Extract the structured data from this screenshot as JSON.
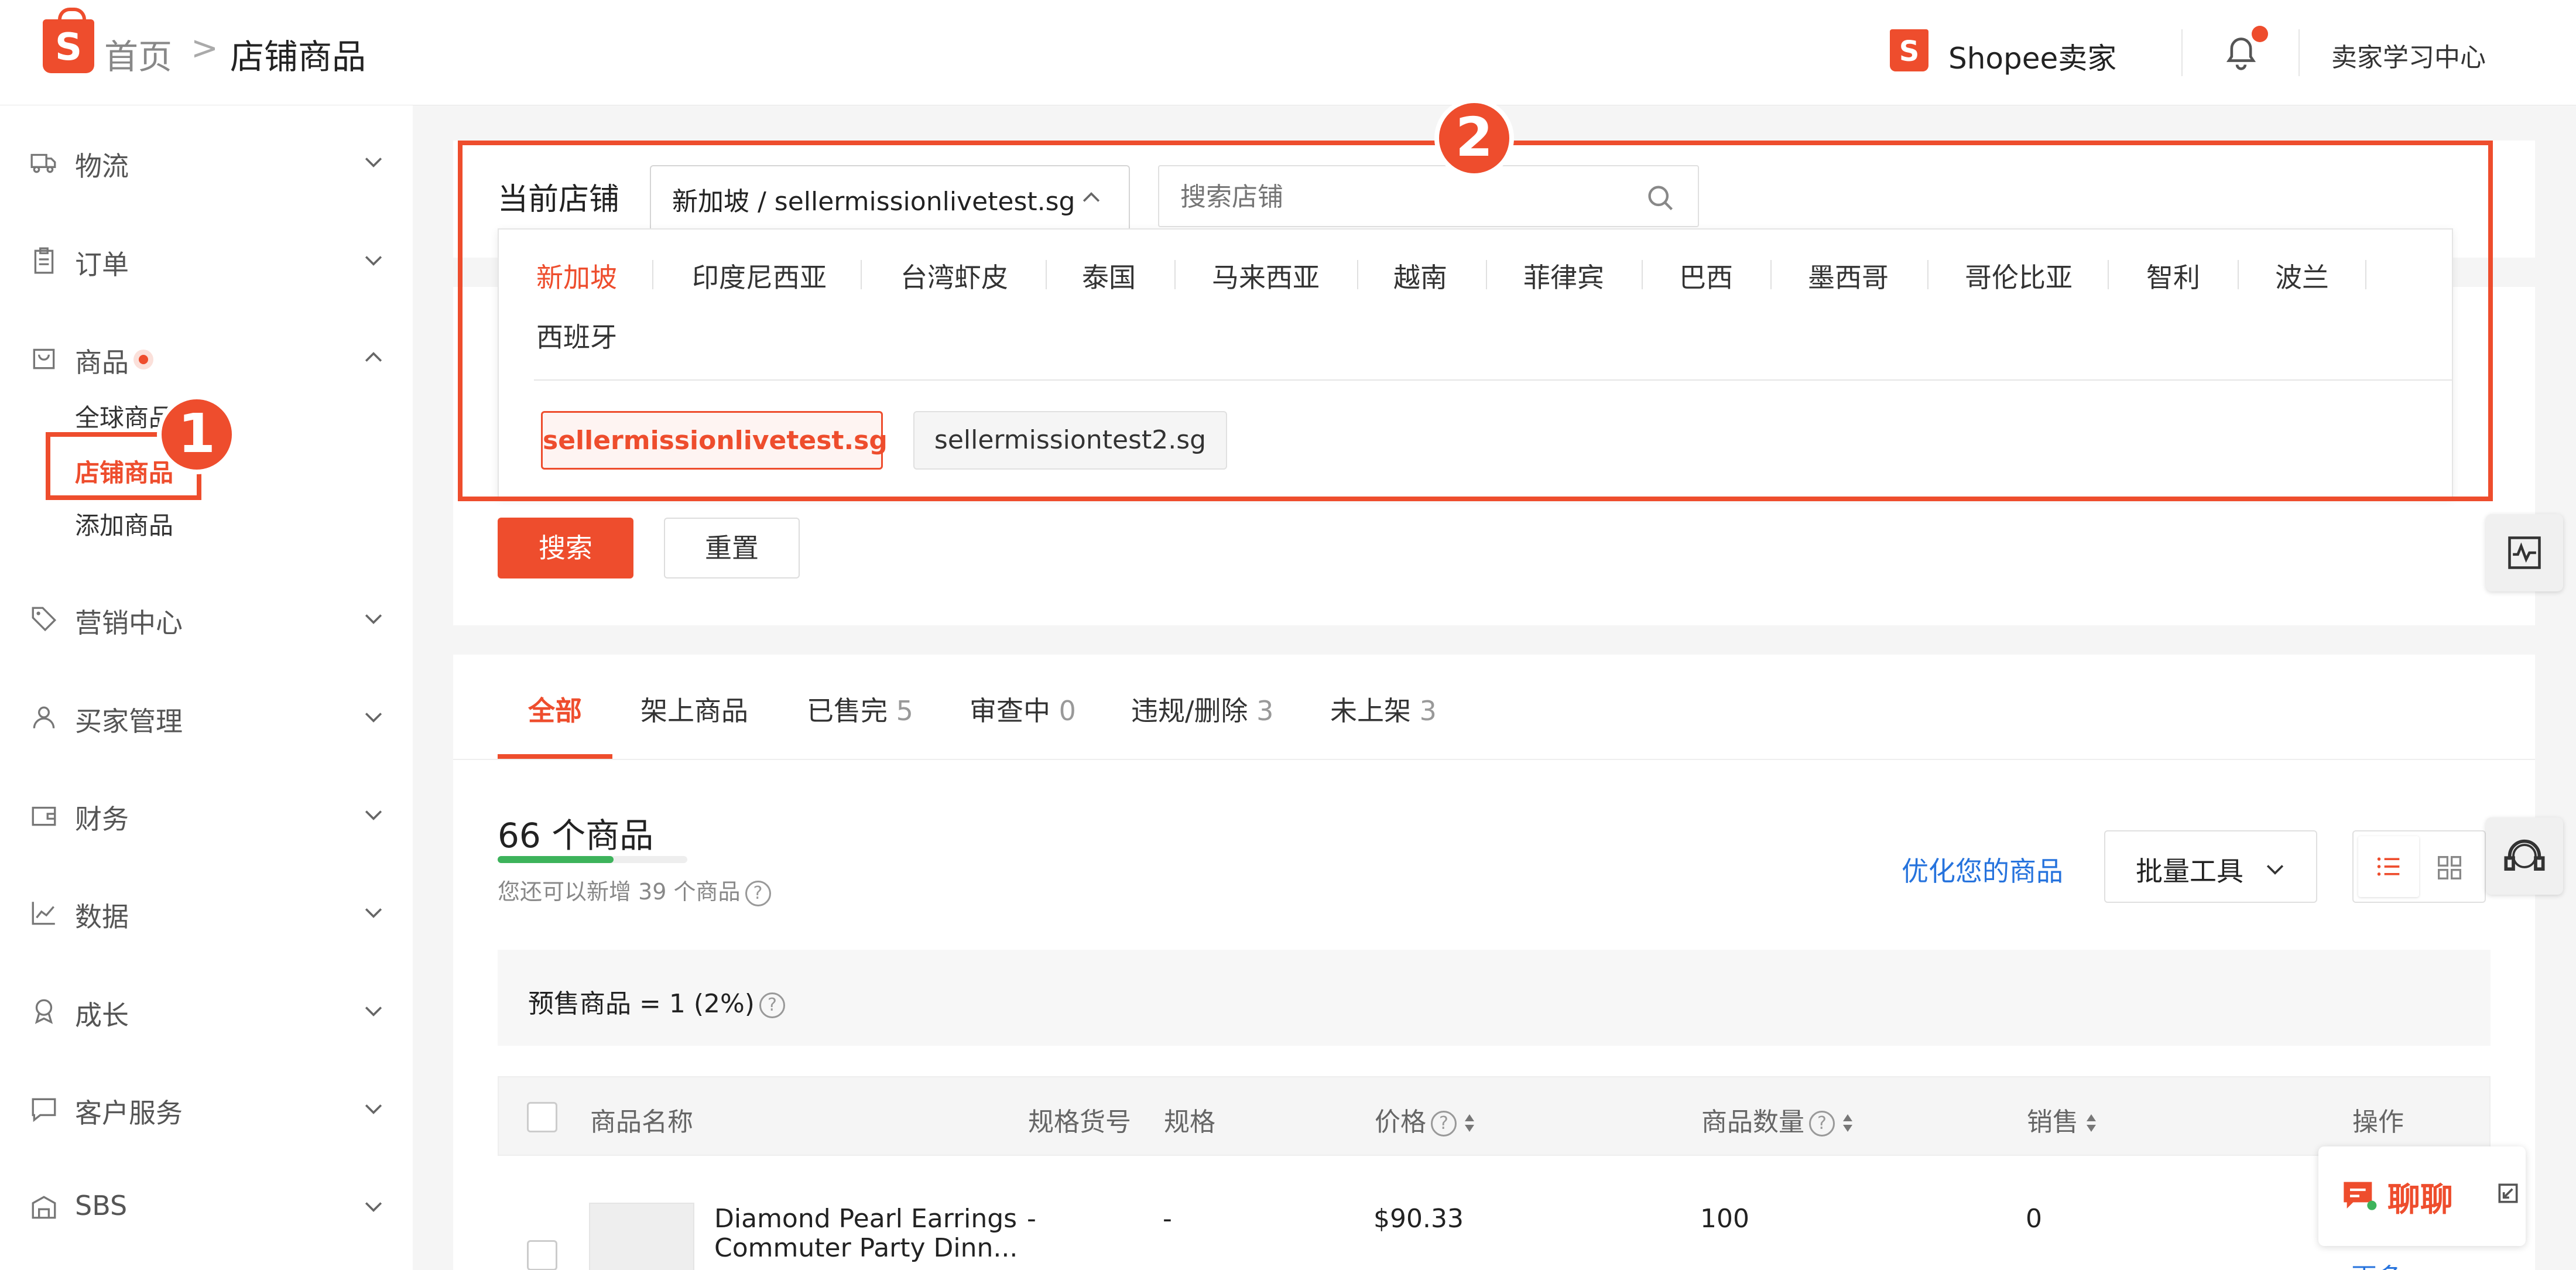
{
  "header": {
    "logo_letter": "S",
    "breadcrumb_home": "首页",
    "breadcrumb_sep": ">",
    "breadcrumb_current": "店铺商品",
    "brand": "Shopee卖家",
    "learning_center": "卖家学习中心"
  },
  "sidebar": {
    "items": [
      {
        "label": "物流"
      },
      {
        "label": "订单"
      },
      {
        "label": "商品"
      },
      {
        "label": "营销中心"
      },
      {
        "label": "买家管理"
      },
      {
        "label": "财务"
      },
      {
        "label": "数据"
      },
      {
        "label": "成长"
      },
      {
        "label": "客户服务"
      },
      {
        "label": "SBS"
      }
    ],
    "product_subitems": [
      {
        "label": "全球商品"
      },
      {
        "label": "店铺商品"
      },
      {
        "label": "添加商品"
      }
    ]
  },
  "annotations": {
    "badge1": "1",
    "badge2": "2"
  },
  "store": {
    "label": "当前店铺",
    "selected": "新加坡 / sellermissionlivetest.sg",
    "search_placeholder": "搜索店铺",
    "countries": [
      "新加坡",
      "印度尼西亚",
      "台湾虾皮",
      "泰国",
      "马来西亚",
      "越南",
      "菲律宾",
      "巴西",
      "墨西哥",
      "哥伦比亚",
      "智利",
      "波兰",
      "西班牙"
    ],
    "shops": [
      "sellermissionlivetest.sg",
      "sellermissiontest2.sg"
    ]
  },
  "filter": {
    "search_button": "搜索",
    "reset_button": "重置"
  },
  "tabs": [
    {
      "label": "全部",
      "count": ""
    },
    {
      "label": "架上商品",
      "count": ""
    },
    {
      "label": "已售完",
      "count": "5"
    },
    {
      "label": "审查中",
      "count": "0"
    },
    {
      "label": "违规/删除",
      "count": "3"
    },
    {
      "label": "未上架",
      "count": "3"
    }
  ],
  "products": {
    "count_text": "66 个商品",
    "quota_text": "您还可以新增 39 个商品",
    "quota_progress": 0.61,
    "optimize_link": "优化您的商品",
    "batch_tools": "批量工具",
    "presale_text": "预售商品 = 1 (2%)",
    "columns": [
      "商品名称",
      "规格货号",
      "规格",
      "价格",
      "商品数量",
      "销售",
      "操作"
    ],
    "rows": [
      {
        "name_line1": "Diamond Pearl Earrings",
        "name_line2": "Commuter Party Dinn...",
        "sku": "-",
        "variation": "-",
        "price": "$90.33",
        "stock": "100",
        "sales": "0",
        "action": "更多"
      }
    ]
  },
  "chat": {
    "label": "聊聊"
  },
  "colors": {
    "brand": "#ee4d2d",
    "link": "#2673dd",
    "progress": "#3db35b"
  }
}
